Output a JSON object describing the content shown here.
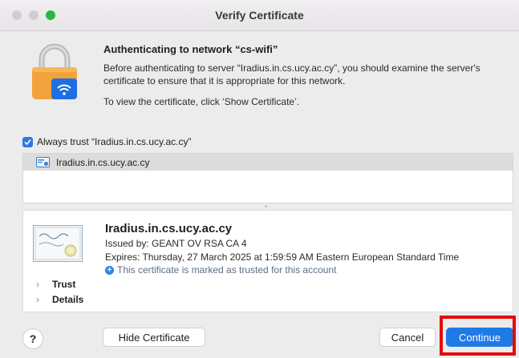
{
  "window": {
    "title": "Verify Certificate"
  },
  "header": {
    "title": "Authenticating to network “cs-wifi”",
    "description": "Before authenticating to server “Iradius.in.cs.ucy.ac.cy”, you should examine the server's certificate to ensure that it is appropriate for this network.",
    "hint": "To view the certificate, click ‘Show Certificate’."
  },
  "trust": {
    "checked": true,
    "label": "Always trust “Iradius.in.cs.ucy.ac.cy”"
  },
  "cert_list": {
    "items": [
      {
        "label": "Iradius.in.cs.ucy.ac.cy",
        "selected": true
      }
    ]
  },
  "details": {
    "name": "Iradius.in.cs.ucy.ac.cy",
    "issued_by": "Issued by: GEANT OV RSA CA 4",
    "expires": "Expires: Thursday, 27 March 2025 at 1:59:59 AM Eastern European Standard Time",
    "trusted_note": "This certificate is marked as trusted for this account",
    "sections": [
      "Trust",
      "Details"
    ]
  },
  "buttons": {
    "help": "?",
    "hide_certificate": "Hide Certificate",
    "cancel": "Cancel",
    "continue": "Continue"
  },
  "colors": {
    "accent": "#1f7ae6",
    "highlight": "#e30b0b",
    "traffic_max": "#2ab640"
  },
  "icons": [
    "lock-wifi-icon",
    "certificate-icon",
    "checkmark-icon",
    "plus-circle-icon",
    "chevron-right-icon"
  ]
}
